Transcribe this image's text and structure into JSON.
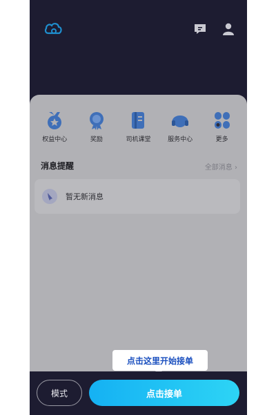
{
  "header": {
    "logo_icon": "cloud-logo-icon",
    "message_icon": "message-icon",
    "user_icon": "user-icon"
  },
  "quick_entries": [
    {
      "label": "权益中心",
      "icon": "badge-icon",
      "color": "#4c7dc9"
    },
    {
      "label": "奖励",
      "icon": "medal-icon",
      "color": "#4c7dc9"
    },
    {
      "label": "司机课堂",
      "icon": "book-icon",
      "color": "#4c7dc9"
    },
    {
      "label": "服务中心",
      "icon": "headset-icon",
      "color": "#4c7dc9"
    },
    {
      "label": "更多",
      "icon": "grid-icon",
      "color": "#4c7dc9"
    }
  ],
  "notice": {
    "title": "消息提醒",
    "all_link": "全部消息 ›",
    "empty_text": "暂无新消息"
  },
  "tooltip": {
    "text": "点击这里开始接单"
  },
  "bottom": {
    "mode_label": "模式",
    "accept_label": "点击接单"
  },
  "colors": {
    "background": "#1d1c31",
    "accent": "#15b1f3",
    "tooltip_text": "#1a4fbf"
  }
}
